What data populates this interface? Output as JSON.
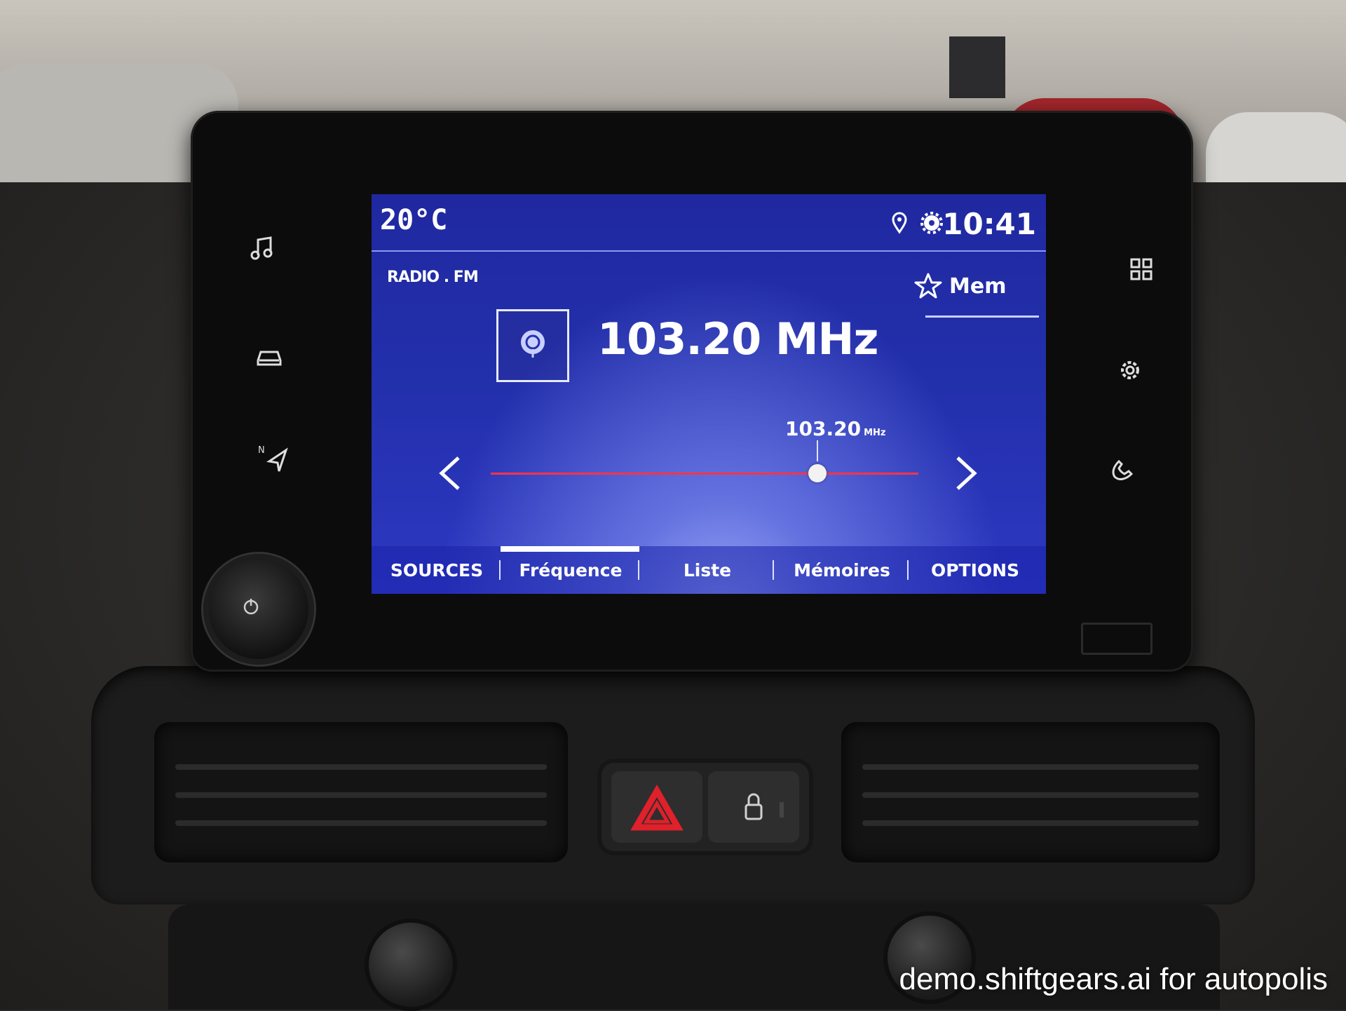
{
  "status_bar": {
    "temperature": "20°C",
    "time": "10:41",
    "icons": [
      "location-pin-icon",
      "gear-icon"
    ]
  },
  "radio": {
    "source": "RADIO . FM",
    "frequency": "103.20 MHz",
    "tuner_frequency": "103.20",
    "tuner_unit": "MHz",
    "tuner_level": 0.75,
    "memory_label": "Mem"
  },
  "tabs": [
    {
      "label": "SOURCES",
      "active": false
    },
    {
      "label": "Fréquence",
      "active": true
    },
    {
      "label": "Liste",
      "active": false
    },
    {
      "label": "Mémoires",
      "active": false
    },
    {
      "label": "OPTIONS",
      "active": false
    }
  ],
  "side_buttons": {
    "left": [
      "music-note-icon",
      "car-icon",
      "navigation-icon"
    ],
    "right": [
      "apps-grid-icon",
      "settings-gear-icon",
      "phone-icon"
    ]
  },
  "colors": {
    "screen_blue": "#2330ac",
    "tuner_track": "#ff3448",
    "hazard_red": "#e0202a"
  },
  "watermark": "demo.shiftgears.ai for autopolis"
}
